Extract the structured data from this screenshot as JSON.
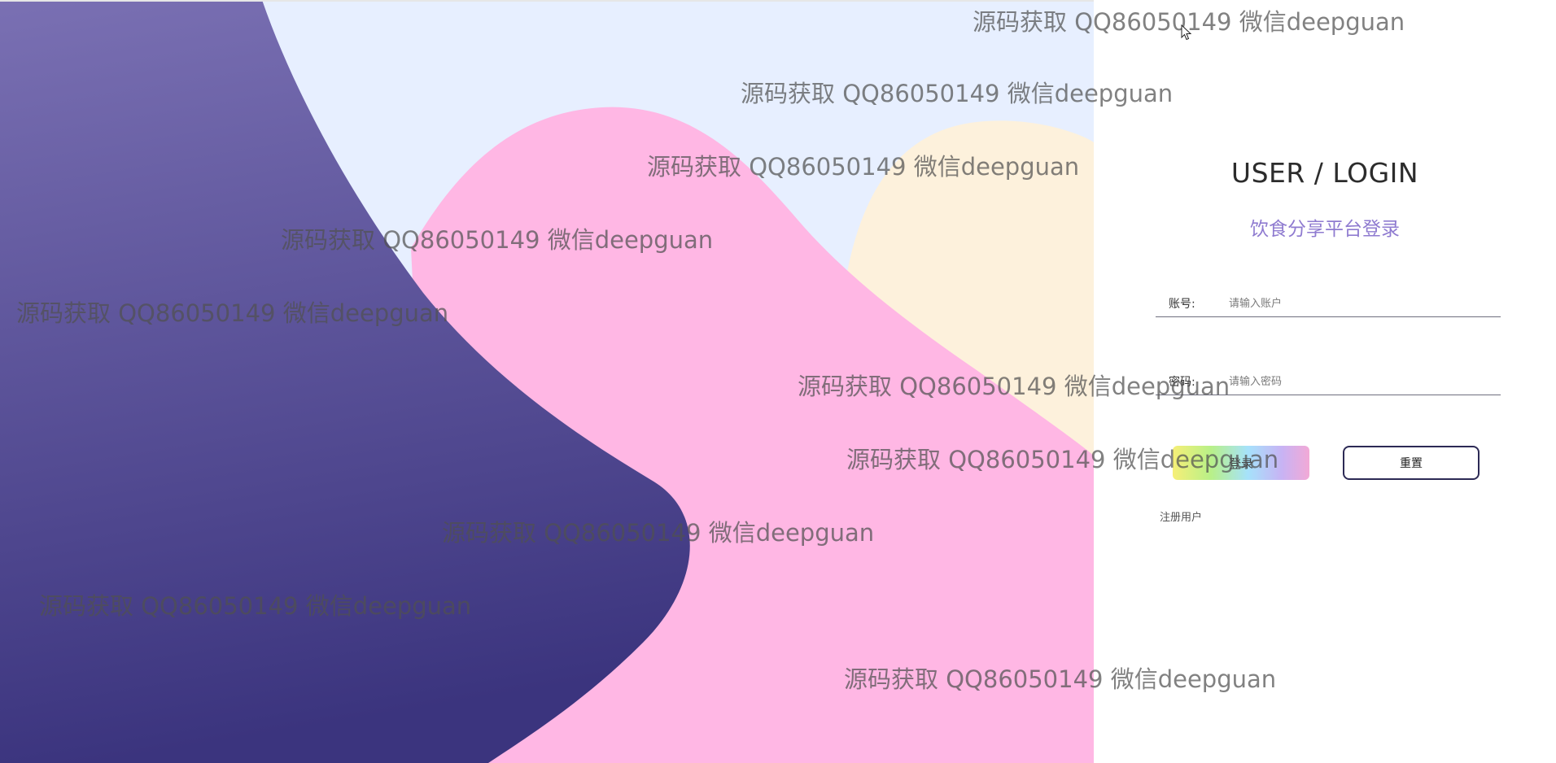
{
  "login": {
    "title": "USER / LOGIN",
    "subtitle": "饮食分享平台登录",
    "account_label": "账号:",
    "account_placeholder": "请输入账户",
    "password_label": "密码:",
    "password_placeholder": "请输入密码",
    "login_button": "登录",
    "reset_button": "重置",
    "register_link": "注册用户"
  },
  "watermark": {
    "text": "源码获取 QQ86050149 微信deepguan"
  },
  "colors": {
    "panel_bg": "#ffffff",
    "bg_light_blue": "#e7efff",
    "bg_pink": "#ffb7e4",
    "bg_cream": "#fdf1dc",
    "bg_indigo_top": "#7a70b3",
    "bg_indigo_bottom": "#3b347e",
    "subtitle": "#8f7bd0",
    "reset_border": "#2c2a55"
  }
}
